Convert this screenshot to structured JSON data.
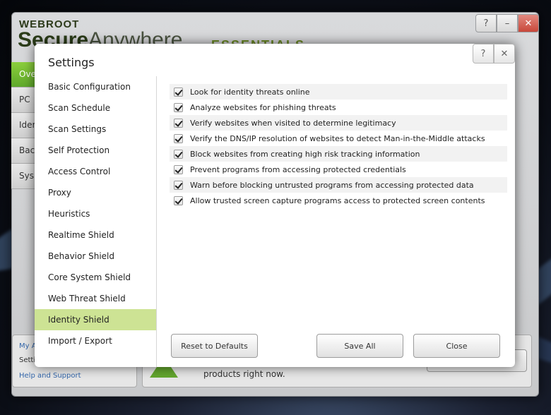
{
  "app": {
    "brand_top": "WEBROOT",
    "brand_bold": "Secure",
    "brand_thin": "Anywhere",
    "edition": "ESSENTIALS",
    "nav": [
      "Ove",
      "PC",
      "Ider",
      "Bac",
      "Sys"
    ],
    "left_links": [
      "My A",
      "Setti",
      "Help and Support"
    ],
    "promo_text": "products right now."
  },
  "dialog": {
    "title": "Settings",
    "nav": [
      "Basic Configuration",
      "Scan Schedule",
      "Scan Settings",
      "Self Protection",
      "Access Control",
      "Proxy",
      "Heuristics",
      "Realtime Shield",
      "Behavior Shield",
      "Core System Shield",
      "Web Threat Shield",
      "Identity Shield",
      "Import / Export"
    ],
    "active_nav": "Identity Shield",
    "options": [
      "Look for identity threats online",
      "Analyze websites for phishing threats",
      "Verify websites when visited to determine legitimacy",
      "Verify the DNS/IP resolution of websites to detect Man-in-the-Middle attacks",
      "Block websites from creating high risk tracking information",
      "Prevent programs from accessing protected credentials",
      "Warn before blocking untrusted programs from accessing protected data",
      "Allow trusted screen capture programs access to protected screen contents"
    ],
    "options_checked": [
      true,
      true,
      true,
      true,
      true,
      true,
      true,
      true
    ],
    "buttons": {
      "reset": "Reset to Defaults",
      "save_all": "Save All",
      "close": "Close"
    }
  },
  "colors": {
    "accent_green": "#cde394",
    "brand_green": "#63a62e",
    "close_red": "#c8473a"
  }
}
